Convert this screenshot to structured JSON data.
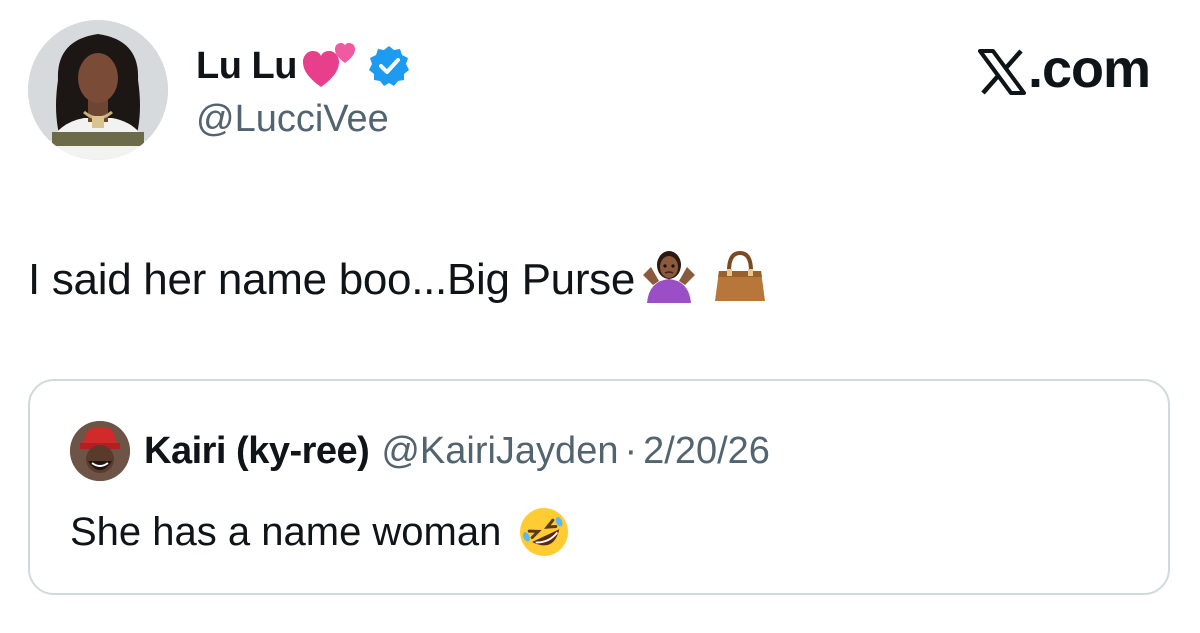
{
  "brand": {
    "label": ".com",
    "logo_icon": "x-logo-icon"
  },
  "author": {
    "name": "Lu Lu",
    "handle": "@LucciVee",
    "name_emoji": "two-hearts-emoji",
    "verified_icon": "verified-badge-icon",
    "verified_color": "#1d9bf0"
  },
  "tweet": {
    "text": "I said her name boo...Big Purse",
    "emojis": [
      "person-shrugging-emoji",
      "handbag-emoji"
    ]
  },
  "quoted_tweet": {
    "name": "Kairi (ky-ree)",
    "handle": "@KairiJayden",
    "separator": "·",
    "date": "2/20/26",
    "text": "She has a name woman",
    "emoji": "rolling-on-floor-laughing-emoji"
  },
  "colors": {
    "text_primary": "#0f1419",
    "text_secondary": "#536471",
    "border": "#cfd9de"
  }
}
